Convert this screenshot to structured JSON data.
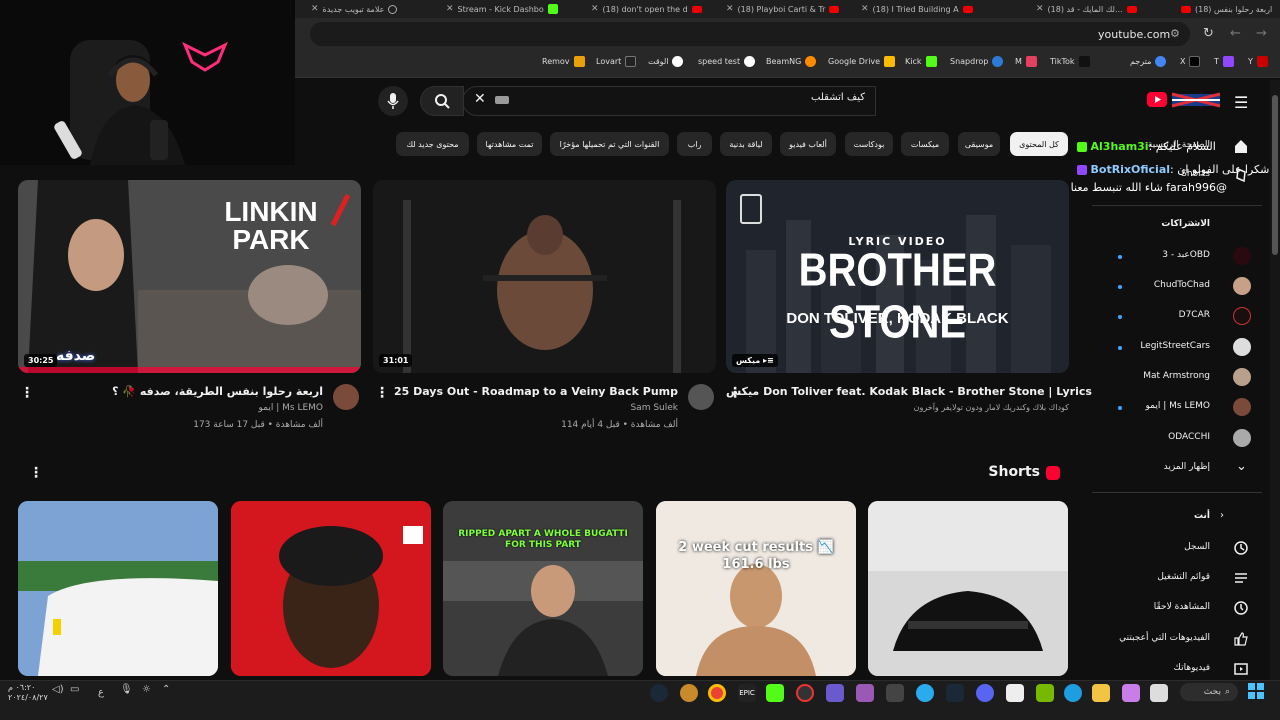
{
  "browser": {
    "tabs": [
      {
        "label": "(18) اربعة رحلوا بنفس"
      },
      {
        "label": "(18) لك المايك - قد..."
      },
      {
        "label": "(18) I Tried Building A"
      },
      {
        "label": "(18) Playboi Carti & Tr"
      },
      {
        "label": "(18) don't open the d"
      },
      {
        "label": "Stream - Kick Dashbo"
      },
      {
        "label": "علامة تبويب جديدة"
      }
    ],
    "address": "youtube.com",
    "bookmarks": [
      "Y",
      "T",
      "X",
      "مترجم",
      "TikTok",
      "M",
      "Snapdrop",
      "Kick",
      "Google Drive",
      "BeamNG",
      "speed test",
      "الوقت",
      "Lovart",
      "Remov"
    ]
  },
  "youtube": {
    "search_query": "كيف اتشقلب",
    "chips": [
      "كل المحتوى",
      "موسيقى",
      "ميكسات",
      "بودكاست",
      "ألعاب فيديو",
      "لياقة بدنية",
      "راب",
      "القنوات التي تم تحميلها مؤخرًا",
      "تمت مشاهدتها",
      "محتوى جديد لك"
    ],
    "videos": [
      {
        "title": "ميكس Don Toliver feat. Kodak Black - Brother Stone | Lyrics",
        "channel": "كوداك بلاك وكندريك لامار ودون تولايفر وآخرون",
        "meta": "",
        "badge": "ميكس",
        "thumb_line1": "LYRIC VIDEO",
        "thumb_line2": "BROTHER STONE",
        "thumb_line3": "DON TOLIVER, KODAK BLACK"
      },
      {
        "title": "25 Days Out - Roadmap to a Veiny Back Pump",
        "channel": "Sam Sulek",
        "meta": "114 ألف مشاهدة • قبل 4 أيام",
        "duration": "31:01"
      },
      {
        "title": "اربعة رحلوا بنفس الطريقة، صدفه 🥀 ؟",
        "channel": "ايمو | Ms LEMO",
        "meta": "173 ألف مشاهدة • قبل 17 ساعة",
        "duration": "30:25",
        "thumb_text": "LINKIN PARK",
        "thumb_caption": "صدفه"
      }
    ],
    "shorts_label": "Shorts",
    "shorts": [
      {
        "caption": ""
      },
      {
        "caption": "2 week cut results 📉 161.6 lbs"
      },
      {
        "caption": "RIPPED APART A WHOLE BUGATTI FOR THIS PART"
      },
      {
        "caption": ""
      },
      {
        "caption": ""
      }
    ],
    "sidebar": {
      "home": "الصفحة الرئيسية",
      "shorts": "Shorts",
      "subscriptions_header": "الاشتراكات",
      "subscriptions": [
        "عبد - 3OBD",
        "ChudToChad",
        "D7CAR",
        "LegitStreetCars",
        "Mat Armstrong",
        "ايمو | Ms LEMO",
        "ODACCHI"
      ],
      "show_more": "إظهار المزيد",
      "you_header": "أنت",
      "you_items": [
        "السجل",
        "قوائم التشغيل",
        "المشاهدة لاحقًا",
        "الفيديوهات التي أعجبتني",
        "فيديوهاتك"
      ]
    }
  },
  "chat_overlay": {
    "line1_user": "Al3ham3i",
    "line1_text": "السلام عليكم",
    "line2_user": "BotRixOficial",
    "line2_text": "شكرا على الفولو ان",
    "line3_text": "@farah996 شاء الله تنبسط معنا"
  },
  "taskbar": {
    "search": "بحث",
    "time": "٠٦:٢٠ م",
    "date": "٢٠٢٤/٠٨/٢٧",
    "lang": "ع"
  },
  "colors": {
    "bg": "#0f0f0f",
    "chip": "#272727",
    "accent": "#ff0033",
    "kick": "#53fc18"
  }
}
